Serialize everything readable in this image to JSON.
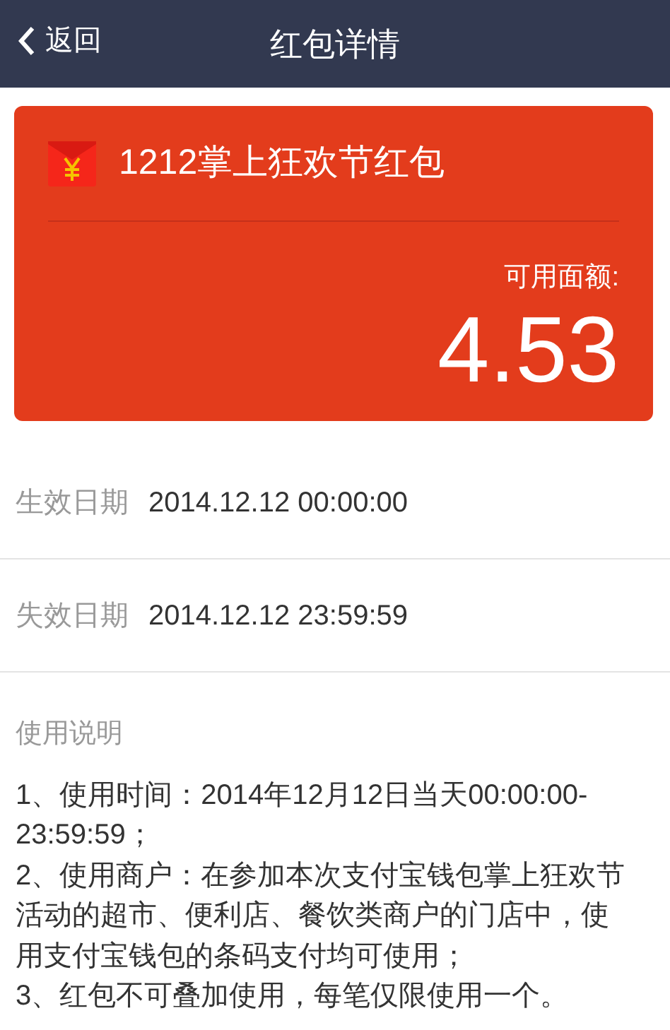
{
  "header": {
    "back_label": "返回",
    "title": "红包详情"
  },
  "coupon": {
    "name": "1212掌上狂欢节红包",
    "balance_label": "可用面额:",
    "balance": "4.53"
  },
  "details": [
    {
      "label": "生效日期",
      "value": "2014.12.12 00:00:00"
    },
    {
      "label": "失效日期",
      "value": "2014.12.12 23:59:59"
    }
  ],
  "instructions": {
    "title": "使用说明",
    "items": [
      "1、使用时间：2014年12月12日当天00:00:00-23:59:59；",
      "2、使用商户：在参加本次支付宝钱包掌上狂欢节活动的超市、便利店、餐饮类商户的门店中，使用支付宝钱包的条码支付均可使用；",
      "3、红包不可叠加使用，每笔仅限使用一个。"
    ]
  }
}
